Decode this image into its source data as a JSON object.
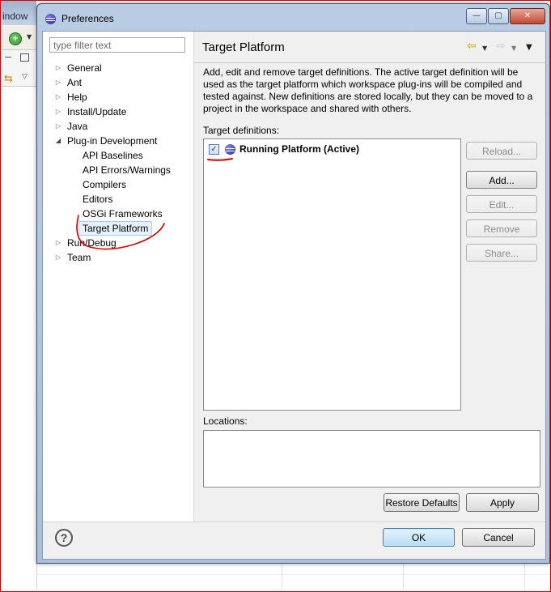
{
  "background": {
    "window_menu_fragment": "indow"
  },
  "dialog": {
    "title": "Preferences",
    "window_buttons": {
      "minimize": "—",
      "maximize": "▢",
      "close": "✕"
    }
  },
  "tree": {
    "filter_placeholder": "type filter text",
    "items": [
      {
        "label": "General",
        "expanded": false
      },
      {
        "label": "Ant",
        "expanded": false
      },
      {
        "label": "Help",
        "expanded": false
      },
      {
        "label": "Install/Update",
        "expanded": false
      },
      {
        "label": "Java",
        "expanded": false
      },
      {
        "label": "Plug-in Development",
        "expanded": true
      },
      {
        "label": "API Baselines"
      },
      {
        "label": "API Errors/Warnings"
      },
      {
        "label": "Compilers"
      },
      {
        "label": "Editors"
      },
      {
        "label": "OSGi Frameworks"
      },
      {
        "label": "Target Platform",
        "selected": true
      },
      {
        "label": "Run/Debug",
        "expanded": false
      },
      {
        "label": "Team",
        "expanded": false
      }
    ]
  },
  "page": {
    "title": "Target Platform",
    "description": "Add, edit and remove target definitions.  The active target definition will be used as the target platform which workspace plug-ins will be compiled and tested against.  New definitions are stored locally, but they can be moved to a project in the workspace and shared with others.",
    "definitions_label": "Target definitions:",
    "definitions": [
      {
        "label": "Running Platform (Active)",
        "checked": true
      }
    ],
    "side_buttons": {
      "reload": "Reload...",
      "add": "Add...",
      "edit": "Edit...",
      "remove": "Remove",
      "share": "Share..."
    },
    "locations_label": "Locations:",
    "restore_defaults": "Restore Defaults",
    "apply": "Apply"
  },
  "footer": {
    "help": "?",
    "ok": "OK",
    "cancel": "Cancel"
  },
  "colors": {
    "annotation": "#d40000",
    "selection_bg": "#e7f1fc",
    "back_arrow": "#d49b00"
  }
}
